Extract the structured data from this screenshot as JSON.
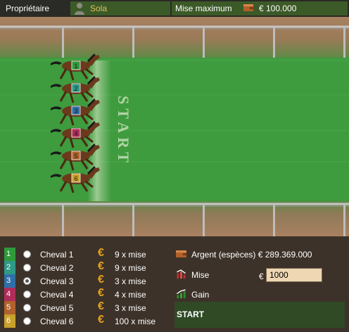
{
  "header": {
    "owner_label": "Propriétaire",
    "owner_name": "Sola",
    "max_bet_label": "Mise maximum",
    "max_bet_value": "€ 100.000",
    "owner_icon": "user-icon",
    "max_bet_icon": "wallet-icon"
  },
  "track": {
    "start_text": "START"
  },
  "horses": [
    {
      "number": "1",
      "color": "#2e9a3a",
      "name": "Cheval 1",
      "odds": "9 x mise",
      "selected": false
    },
    {
      "number": "2",
      "color": "#2e9a87",
      "name": "Cheval 2",
      "odds": "9 x mise",
      "selected": false
    },
    {
      "number": "3",
      "color": "#2f6fa6",
      "name": "Cheval 3",
      "odds": "3 x mise",
      "selected": true
    },
    {
      "number": "4",
      "color": "#b02c5a",
      "name": "Cheval 4",
      "odds": "4 x mise",
      "selected": false
    },
    {
      "number": "5",
      "color": "#b0622c",
      "name": "Cheval 5",
      "odds": "3 x mise",
      "selected": false
    },
    {
      "number": "6",
      "color": "#c8a02c",
      "name": "Cheval 6",
      "odds": "100 x mise",
      "selected": false
    }
  ],
  "currency_symbol": "€",
  "bet_panel": {
    "cash_label": "Argent (espèces)",
    "cash_value": "€ 289.369.000",
    "stake_label": "Mise",
    "stake_currency": "€",
    "stake_value": "1000",
    "gain_label": "Gain",
    "start_button": "START"
  },
  "colors": {
    "grass": "#3d9a3d",
    "dirt": "#a0795a",
    "panel": "#3d3229",
    "accent_green": "#3c5a28"
  }
}
